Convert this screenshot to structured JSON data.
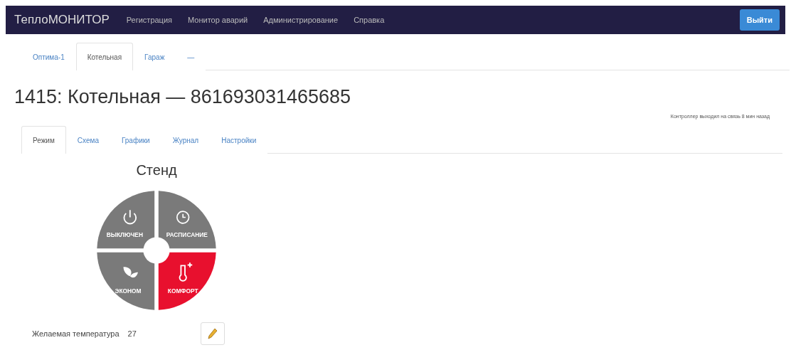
{
  "navbar": {
    "brand": "ТеплоМОНИТОР",
    "links": [
      "Регистрация",
      "Монитор аварий",
      "Администрирование",
      "Справка"
    ],
    "logout": "Выйти"
  },
  "object_tabs": [
    {
      "label": "Оптима-1",
      "selected": false
    },
    {
      "label": "Котельная",
      "selected": true
    },
    {
      "label": "Гараж",
      "selected": false
    },
    {
      "label": "—",
      "selected": false
    }
  ],
  "title": "1415: Котельная — 861693031465685",
  "status_note": "Контроллер выходил на связь 8 мин назад",
  "section_tabs": [
    {
      "label": "Режим",
      "selected": true
    },
    {
      "label": "Схема",
      "selected": false
    },
    {
      "label": "Графики",
      "selected": false
    },
    {
      "label": "Журнал",
      "selected": false
    },
    {
      "label": "Настройки",
      "selected": false
    }
  ],
  "mode_dial": {
    "title": "Стенд",
    "modes": [
      {
        "kind": "power",
        "label": "ВЫКЛЮЧЕН",
        "selected": false
      },
      {
        "kind": "schedule",
        "label": "РАСПИСАНИЕ",
        "selected": false
      },
      {
        "kind": "eco",
        "label": "ЭКОНОМ",
        "selected": false
      },
      {
        "kind": "comfort",
        "label": "КОМФОРТ",
        "selected": true
      }
    ]
  },
  "desired_temperature": {
    "label": "Желаемая температура",
    "value": "27"
  }
}
